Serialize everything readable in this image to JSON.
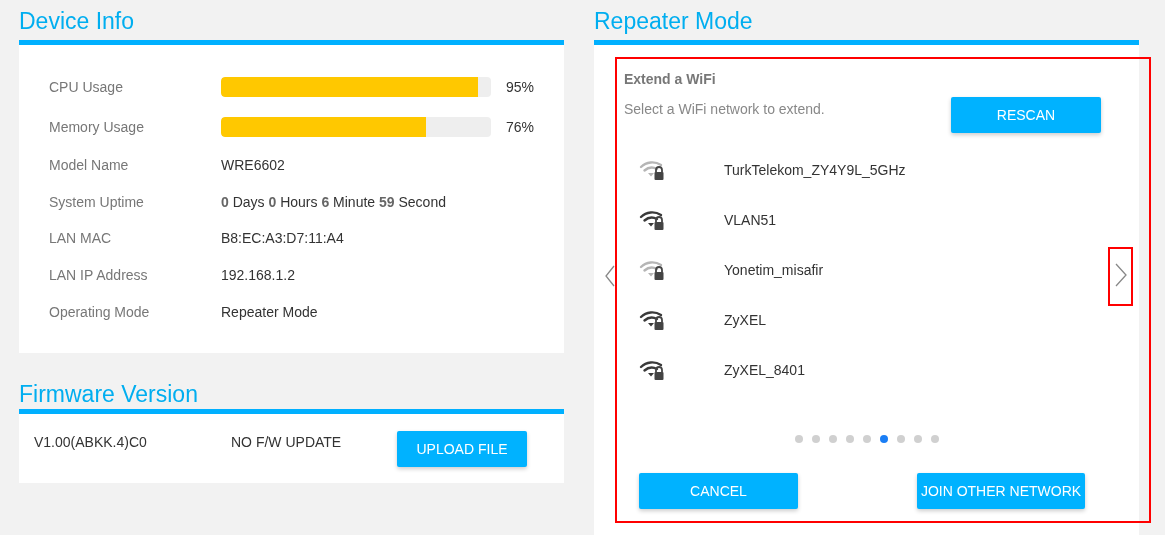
{
  "device_info": {
    "title": "Device Info",
    "meters": [
      {
        "label": "CPU Usage",
        "level": 0.95,
        "reading": "95%"
      },
      {
        "label": "Memory Usage",
        "level": 0.76,
        "reading": "76%"
      }
    ],
    "fields": [
      {
        "label": "Model Name",
        "value": "WRE6602"
      },
      {
        "label": "System Uptime",
        "value": "**0** Days **0** Hours **6** Minute **59** Second"
      },
      {
        "label": "LAN MAC",
        "value": "B8:EC:A3:D7:11:A4"
      },
      {
        "label": "LAN IP Address",
        "value": "192.168.1.2"
      },
      {
        "label": "Operating Mode",
        "value": "Repeater Mode"
      }
    ]
  },
  "firmware": {
    "title": "Firmware Version",
    "version": "V1.00(ABKK.4)C0",
    "status": "NO F/W UPDATE",
    "button": "UPLOAD FILE"
  },
  "repeater": {
    "title": "Repeater Mode",
    "heading": "Extend a WiFi",
    "description": "Select a WiFi network to extend.",
    "rescan_button": "RESCAN",
    "networks": [
      {
        "name": "TurkTelekom_ZY4Y9L_5GHz",
        "strong_signal": false
      },
      {
        "name": "VLAN51",
        "strong_signal": true
      },
      {
        "name": "Yonetim_misafir",
        "strong_signal": false
      },
      {
        "name": "ZyXEL",
        "strong_signal": true
      },
      {
        "name": "ZyXEL_8401",
        "strong_signal": true
      }
    ],
    "pages": [
      {
        "selected": false
      },
      {
        "selected": false
      },
      {
        "selected": false
      },
      {
        "selected": false
      },
      {
        "selected": false
      },
      {
        "selected": true
      },
      {
        "selected": false
      },
      {
        "selected": false
      },
      {
        "selected": false
      }
    ],
    "cancel_button": "CANCEL",
    "join_button": "JOIN OTHER NETWORK"
  }
}
